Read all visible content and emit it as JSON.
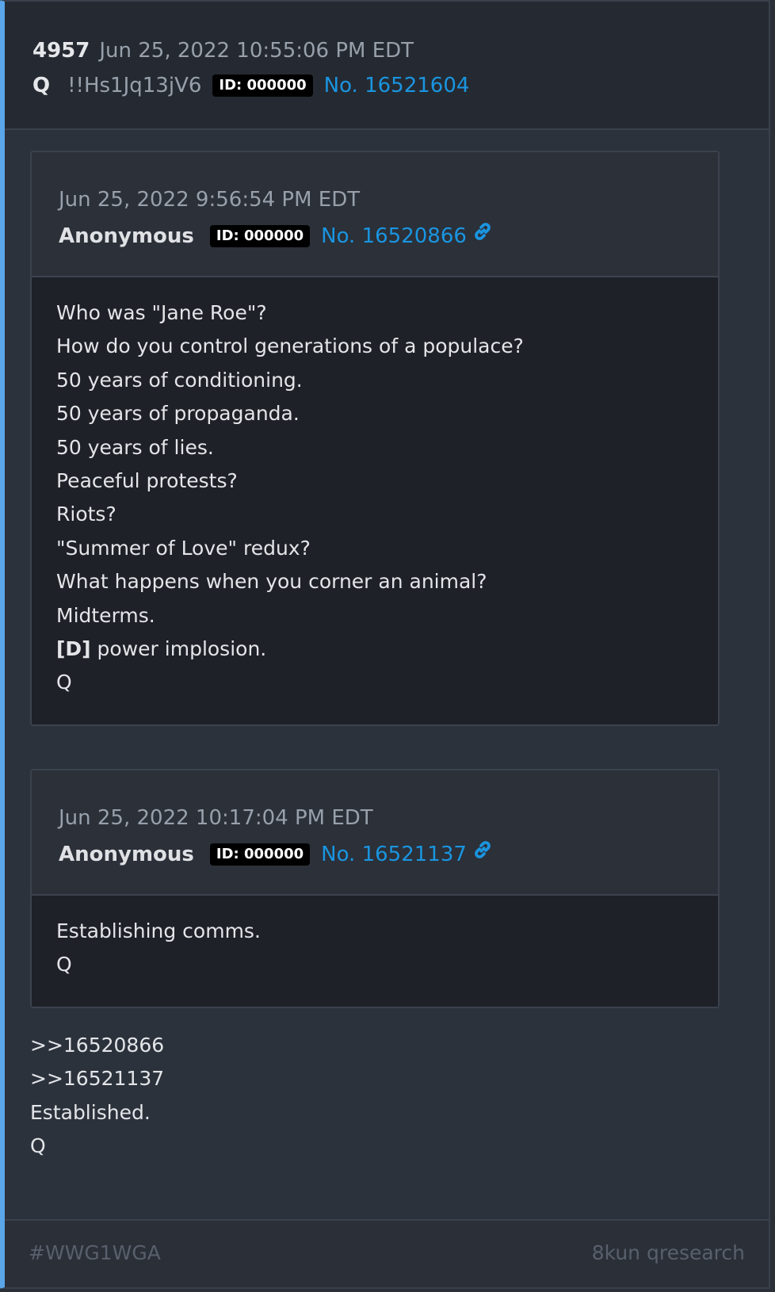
{
  "post": {
    "number": "4957",
    "timestamp": "Jun 25, 2022 10:55:06 PM EDT",
    "author": "Q",
    "tripcode": "!!Hs1Jq13jV6",
    "id_badge": "ID: 000000",
    "post_link": "No. 16521604",
    "body_lines": [
      ">>16520866",
      ">>16521137",
      "Established.",
      "Q"
    ]
  },
  "quotes": [
    {
      "timestamp": "Jun 25, 2022 9:56:54 PM EDT",
      "author": "Anonymous",
      "id_badge": "ID: 000000",
      "post_link": "No. 16520866",
      "body_lines": [
        "Who was \"Jane Roe\"?",
        "How do you control generations of a populace?",
        "50 years of conditioning.",
        "50 years of propaganda.",
        "50 years of lies.",
        "Peaceful protests?",
        "Riots?",
        "\"Summer of Love\" redux?",
        "What happens when you corner an animal?",
        "Midterms.",
        " power implosion.",
        "Q"
      ],
      "bold_prefix": "[D]"
    },
    {
      "timestamp": "Jun 25, 2022 10:17:04 PM EDT",
      "author": "Anonymous",
      "id_badge": "ID: 000000",
      "post_link": "No. 16521137",
      "body_lines": [
        "Establishing comms.",
        "Q"
      ]
    }
  ],
  "footer": {
    "hashtag": "#WWG1WGA",
    "board": "8kun qresearch"
  },
  "icons": {
    "link": "link-icon"
  },
  "colors": {
    "accent_border": "#5aa6e8",
    "link": "#1a95e0"
  }
}
